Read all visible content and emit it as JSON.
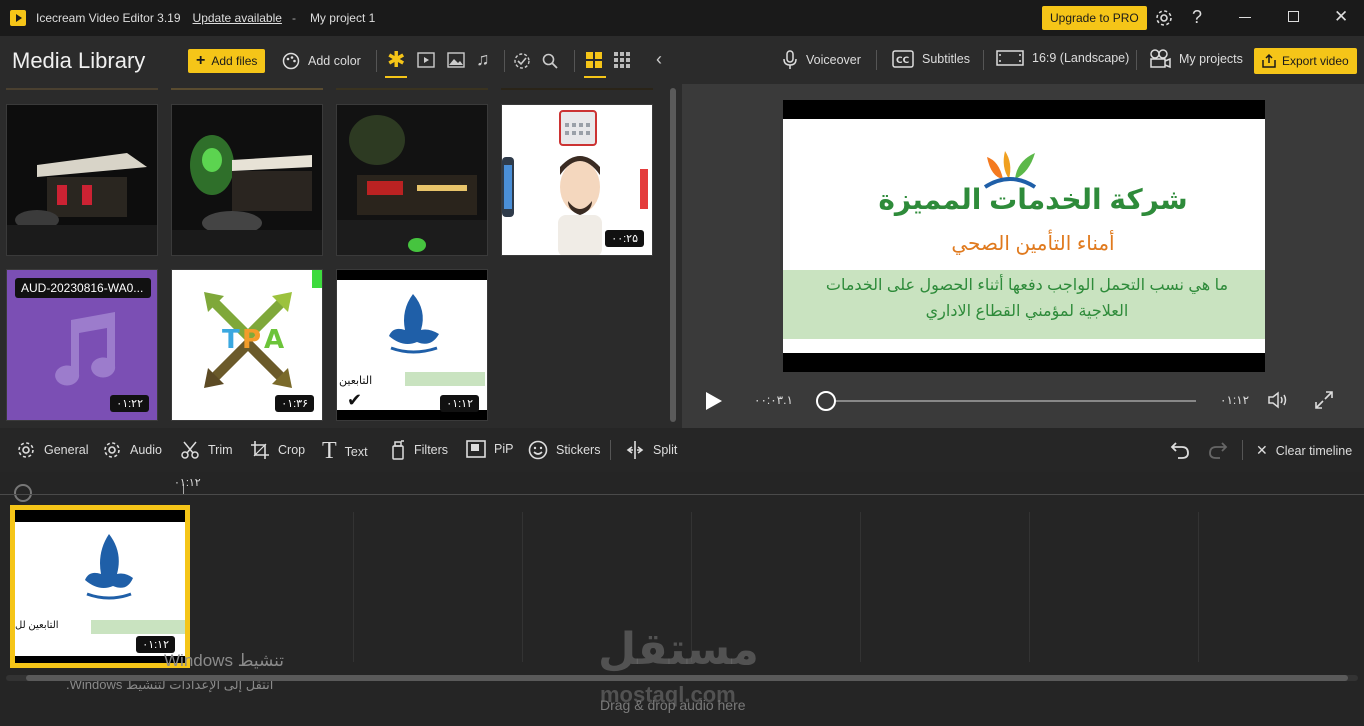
{
  "titlebar": {
    "app_title": "Icecream Video Editor 3.19",
    "update_link": "Update available",
    "separator": "-",
    "project_name": "My project 1",
    "upgrade_label": "Upgrade to PRO"
  },
  "library": {
    "title": "Media Library",
    "add_files": "Add files",
    "add_color": "Add color",
    "thumbs": [
      {
        "kind": "night-photo",
        "duration": ""
      },
      {
        "kind": "night-photo",
        "duration": ""
      },
      {
        "kind": "night-photo",
        "duration": ""
      },
      {
        "kind": "cartoon-video",
        "duration": "۰۰:۲۵"
      },
      {
        "kind": "audio",
        "name": "AUD-20230816-WA0...",
        "duration": "۰۱:۲۲"
      },
      {
        "kind": "tpa-video",
        "duration": "۰۱:۳۶"
      },
      {
        "kind": "document-video",
        "duration": "۰۱:۱۲",
        "caption": "التابعين"
      }
    ]
  },
  "preview": {
    "voiceover": "Voiceover",
    "subtitles": "Subtitles",
    "aspect": "16:9 (Landscape)",
    "my_projects": "My projects",
    "export": "Export video",
    "slide": {
      "company": "شركة الخدمات المميزة",
      "subtitle": "أمناء التأمين الصحي",
      "question": "ما هي نسب التحمل الواجب دفعها أثناء الحصول على الخدمات العلاجية لمؤمني القطاع الاداري"
    },
    "current_time": "۰۰:۰۳.۱",
    "total_time": "۰۱:۱۲",
    "progress": 0.02
  },
  "edit_toolbar": {
    "general": "General",
    "audio": "Audio",
    "trim": "Trim",
    "crop": "Crop",
    "text": "Text",
    "filters": "Filters",
    "pip": "PiP",
    "stickers": "Stickers",
    "split": "Split",
    "clear": "Clear timeline"
  },
  "timeline": {
    "marker_time": "۰۱:۱۲",
    "clip_duration": "۰۱:۱۲",
    "clip_caption": "التابعين لل",
    "drop_hint": "Drag & drop audio here",
    "watermark_logo": "مستقل",
    "watermark_url": "mostaql.com",
    "activation_title": "تنشيط Windows",
    "activation_sub": "انتقل إلى الإعدادات لتنشيط Windows."
  },
  "colors": {
    "accent": "#f5c518",
    "green_text": "#2e8b3a",
    "blue_text": "#1f5fa8",
    "orange_text": "#e07a1e",
    "band": "#c9e3c0"
  }
}
